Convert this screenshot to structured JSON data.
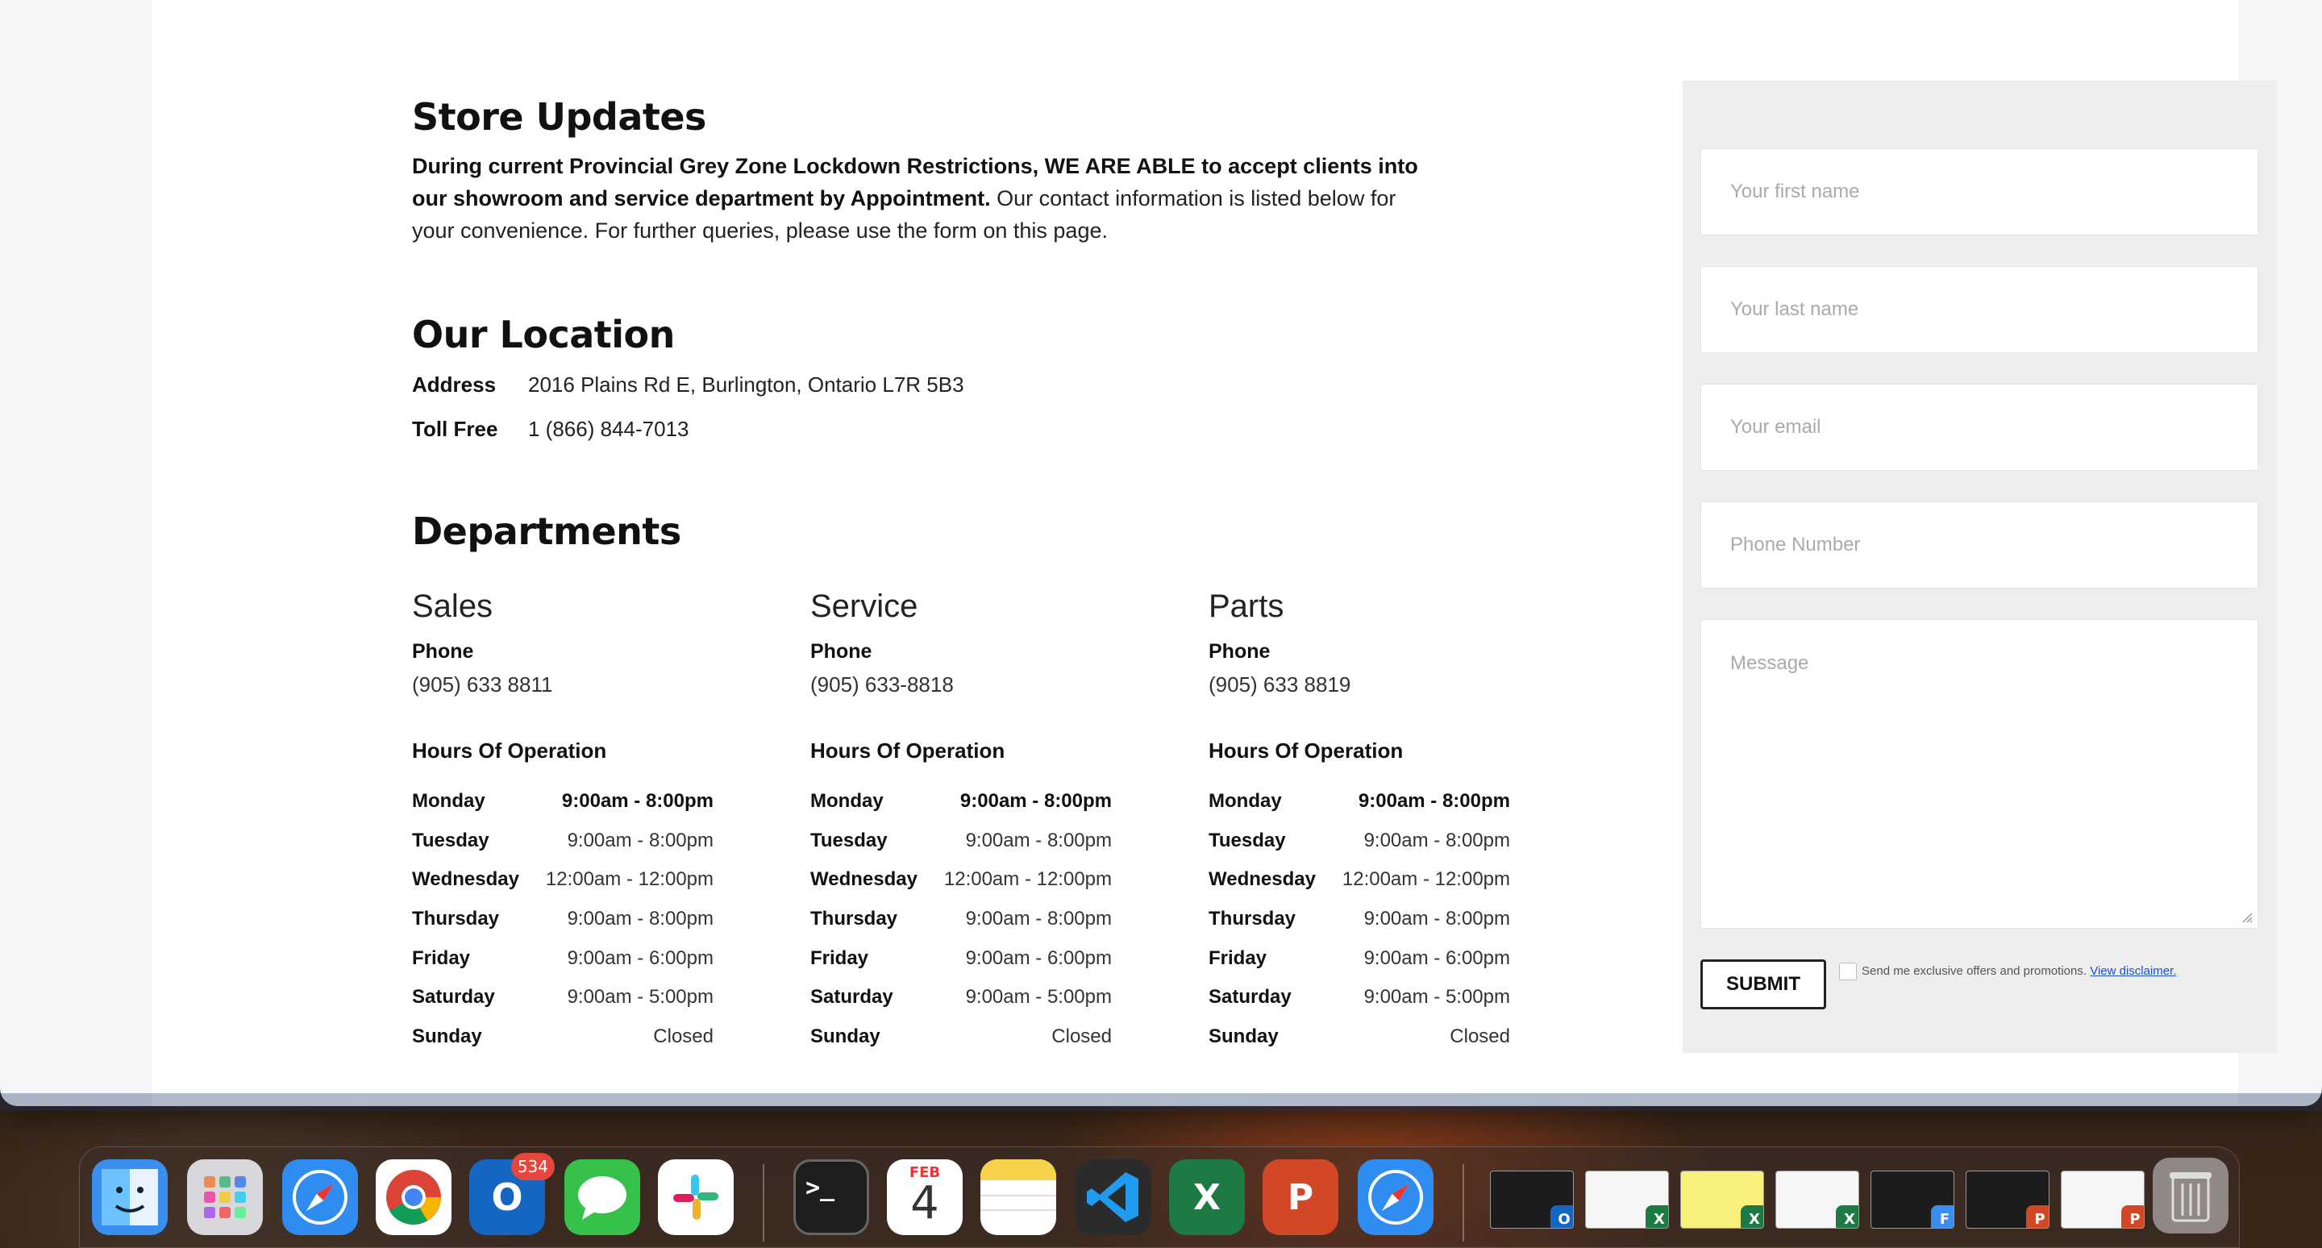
{
  "store_updates": {
    "title": "Store Updates",
    "bold_text": "During current Provincial Grey Zone Lockdown Restrictions, WE ARE ABLE to accept clients into our showroom and service department by Appointment.",
    "regular_text": " Our contact information is listed below for your convenience. For further queries, please use the form on this page."
  },
  "location": {
    "title": "Our Location",
    "address_label": "Address",
    "address_value": "2016 Plains Rd E, Burlington, Ontario L7R 5B3",
    "tollfree_label": "Toll Free",
    "tollfree_value": "1 (866) 844-7013"
  },
  "departments": {
    "title": "Departments",
    "items": [
      {
        "name": "Sales",
        "phone_label": "Phone",
        "phone": "(905) 633 8811",
        "hours_title": "Hours Of Operation",
        "hours": [
          {
            "day": "Monday",
            "time": "9:00am - 8:00pm"
          },
          {
            "day": "Tuesday",
            "time": "9:00am - 8:00pm"
          },
          {
            "day": "Wednesday",
            "time": "12:00am - 12:00pm"
          },
          {
            "day": "Thursday",
            "time": "9:00am - 8:00pm"
          },
          {
            "day": "Friday",
            "time": "9:00am - 6:00pm"
          },
          {
            "day": "Saturday",
            "time": "9:00am - 5:00pm"
          },
          {
            "day": "Sunday",
            "time": "Closed"
          }
        ]
      },
      {
        "name": "Service",
        "phone_label": "Phone",
        "phone": "(905) 633-8818",
        "hours_title": "Hours Of Operation",
        "hours": [
          {
            "day": "Monday",
            "time": "9:00am - 8:00pm"
          },
          {
            "day": "Tuesday",
            "time": "9:00am - 8:00pm"
          },
          {
            "day": "Wednesday",
            "time": "12:00am - 12:00pm"
          },
          {
            "day": "Thursday",
            "time": "9:00am - 8:00pm"
          },
          {
            "day": "Friday",
            "time": "9:00am - 6:00pm"
          },
          {
            "day": "Saturday",
            "time": "9:00am - 5:00pm"
          },
          {
            "day": "Sunday",
            "time": "Closed"
          }
        ]
      },
      {
        "name": "Parts",
        "phone_label": "Phone",
        "phone": "(905) 633 8819",
        "hours_title": "Hours Of Operation",
        "hours": [
          {
            "day": "Monday",
            "time": "9:00am - 8:00pm"
          },
          {
            "day": "Tuesday",
            "time": "9:00am - 8:00pm"
          },
          {
            "day": "Wednesday",
            "time": "12:00am - 12:00pm"
          },
          {
            "day": "Thursday",
            "time": "9:00am - 8:00pm"
          },
          {
            "day": "Friday",
            "time": "9:00am - 6:00pm"
          },
          {
            "day": "Saturday",
            "time": "9:00am - 5:00pm"
          },
          {
            "day": "Sunday",
            "time": "Closed"
          }
        ]
      }
    ]
  },
  "form": {
    "first_name_placeholder": "Your first name",
    "last_name_placeholder": "Your last name",
    "email_placeholder": "Your email",
    "phone_placeholder": "Phone Number",
    "message_placeholder": "Message",
    "submit_label": "SUBMIT",
    "consent_text": "Send me exclusive offers and promotions.",
    "disclaimer_link": "View disclaimer."
  },
  "dock": {
    "apps": [
      {
        "name": "Finder",
        "icon": "finder-icon",
        "color": "#3a8ef0"
      },
      {
        "name": "Launchpad",
        "icon": "launchpad-icon",
        "color": "#d8d8dc"
      },
      {
        "name": "Safari",
        "icon": "safari-icon",
        "color": "#2f8cf0"
      },
      {
        "name": "Chrome",
        "icon": "chrome-icon",
        "color": "#ffffff"
      },
      {
        "name": "Outlook",
        "icon": "outlook-icon",
        "color": "#1466c0",
        "badge": "534"
      },
      {
        "name": "Messages",
        "icon": "messages-icon",
        "color": "#36c24a"
      },
      {
        "name": "Slack",
        "icon": "slack-icon",
        "color": "#ffffff"
      },
      {
        "name": "Terminal",
        "icon": "terminal-icon",
        "color": "#1e1e1e"
      },
      {
        "name": "Calendar",
        "icon": "calendar-icon",
        "color": "#ffffff",
        "month": "FEB",
        "day": "4"
      },
      {
        "name": "Notes",
        "icon": "notes-icon",
        "color": "#ffffff"
      },
      {
        "name": "VS Code",
        "icon": "vscode-icon",
        "color": "#2b2b2b"
      },
      {
        "name": "Excel",
        "icon": "excel-icon",
        "color": "#1d7a45"
      },
      {
        "name": "PowerPoint",
        "icon": "powerpoint-icon",
        "color": "#d24726"
      },
      {
        "name": "Safari",
        "icon": "safari-icon",
        "color": "#2f8cf0"
      }
    ]
  }
}
